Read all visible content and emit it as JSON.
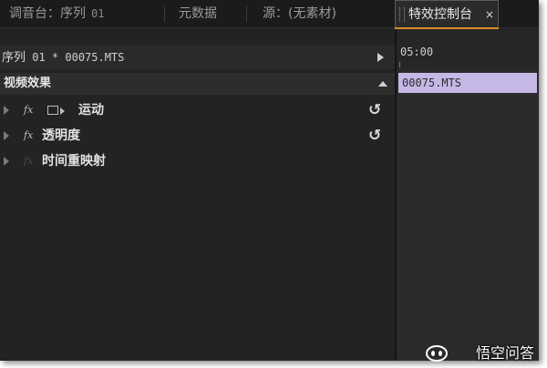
{
  "tabs": [
    {
      "label": "调音台：序列",
      "sub": "01"
    },
    {
      "label": "元数据"
    },
    {
      "label": "源：(无素材)"
    },
    {
      "label": "特效控制台",
      "close": "×"
    }
  ],
  "effect_controls": {
    "sequence_label": "序列",
    "sequence_clip": " 01 * 00075.MTS",
    "video_effects_header": "视频效果",
    "effects": [
      {
        "fx": "fx",
        "name": "运动",
        "reset": "↺"
      },
      {
        "fx": "fx",
        "name": "透明度",
        "reset": "↺"
      },
      {
        "fx": "fx",
        "name": "时间重映射"
      }
    ]
  },
  "timeline": {
    "time": "05:00",
    "clip_name": "00075.MTS"
  },
  "watermark": {
    "text": "悟空问答"
  },
  "colors": {
    "accent_tab": "#d98a2a",
    "clip_bar": "#c6b8e6",
    "panel_bg": "#232323"
  }
}
